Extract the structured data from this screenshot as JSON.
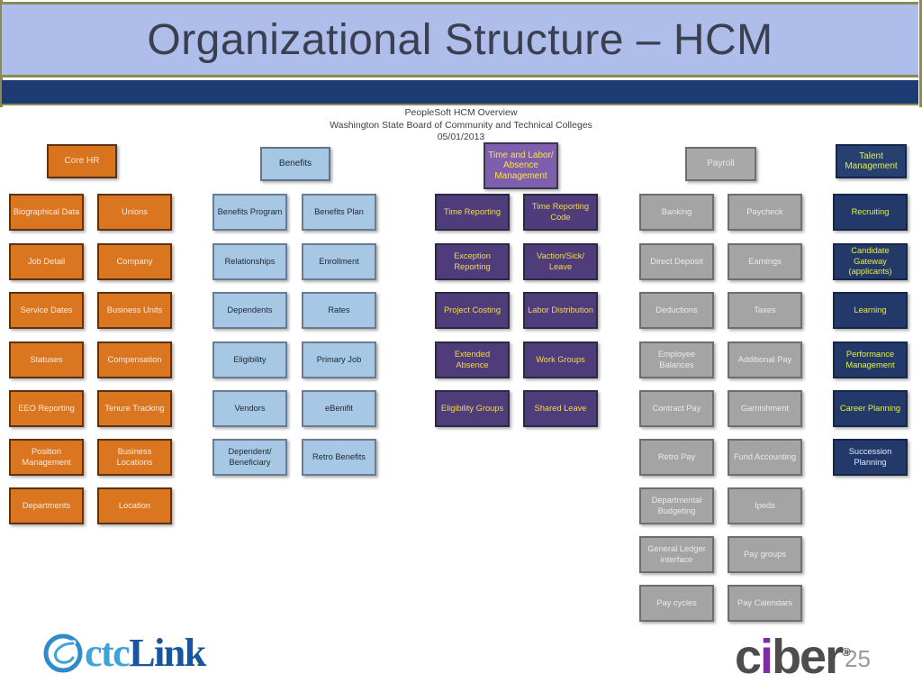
{
  "slide": {
    "title": "Organizational Structure – HCM",
    "slide_number": "25",
    "subtitle": {
      "line1": "PeopleSoft HCM Overview",
      "line2": "Washington State Board of Community and Technical Colleges",
      "line3": "05/01/2013"
    },
    "banner_color": "#aebde9",
    "banner_border_color": "#8a8b52",
    "banner_bar_color": "#1f3b73",
    "title_color": "#3a4050"
  },
  "columns": [
    {
      "id": "core-hr",
      "header": "Core HR",
      "accent": "#d9741e",
      "nodes_left": [
        "Biographical Data",
        "Job Detail",
        "Service Dates",
        "Statuses",
        "EEO Reporting",
        "Position Management",
        "Departments"
      ],
      "nodes_right": [
        "Unions",
        "Company",
        "Business Units",
        "Compensation",
        "Tenure Tracking",
        "Business Locations",
        "Location"
      ]
    },
    {
      "id": "benefits",
      "header": "Benefits",
      "accent": "#a6c7e3",
      "nodes_left": [
        "Benefits Program",
        "Relationships",
        "Dependents",
        "Eligibility",
        "Vendors",
        "Dependent/ Beneficiary"
      ],
      "nodes_right": [
        "Benefits Plan",
        "Enrollment",
        "Rates",
        "Primary Job",
        "eBenifit",
        "Retro Benefits"
      ]
    },
    {
      "id": "time-labor-absence",
      "header": "Time and Labor/ Absence Management",
      "accent": "#7e5fae",
      "nodes_left": [
        "Time Reporting",
        "Exception Reporting",
        "Project Costing",
        "Extended Absence",
        "Eligibility Groups"
      ],
      "nodes_right": [
        "Time Reporting Code",
        "Vaction/Sick/ Leave",
        "Labor Distribution",
        "Work Groups",
        "Shared Leave"
      ]
    },
    {
      "id": "payroll",
      "header": "Payroll",
      "accent": "#a8a8a8",
      "nodes_left": [
        "Banking",
        "Direct Deposit",
        "Deductions",
        "Employee Balances",
        "Contract Pay",
        "Retro Pay",
        "Departmental Budgeting",
        "General Ledger interface",
        "Pay cycles"
      ],
      "nodes_right": [
        "Paycheck",
        "Earnings",
        "Taxes",
        "Additional Pay",
        "Garnishment",
        "Fund Accounting",
        "Ipeds",
        "Pay groups",
        "Pay Calendars"
      ]
    },
    {
      "id": "talent-management",
      "header": "Talent Management",
      "accent": "#27406f",
      "nodes_left": [
        "Recruiting",
        "Candidate Gateway (applicants)",
        "Learning",
        "Performance Management",
        "Career Planning",
        "Succession Planning"
      ],
      "nodes_right": []
    }
  ],
  "logos": {
    "ctclink": {
      "c1": "ctc",
      "link": "Link",
      "swirl": "swirl-icon"
    },
    "ciber": {
      "pre": "c",
      "i": "i",
      "post": "ber",
      "registered": "®"
    }
  }
}
